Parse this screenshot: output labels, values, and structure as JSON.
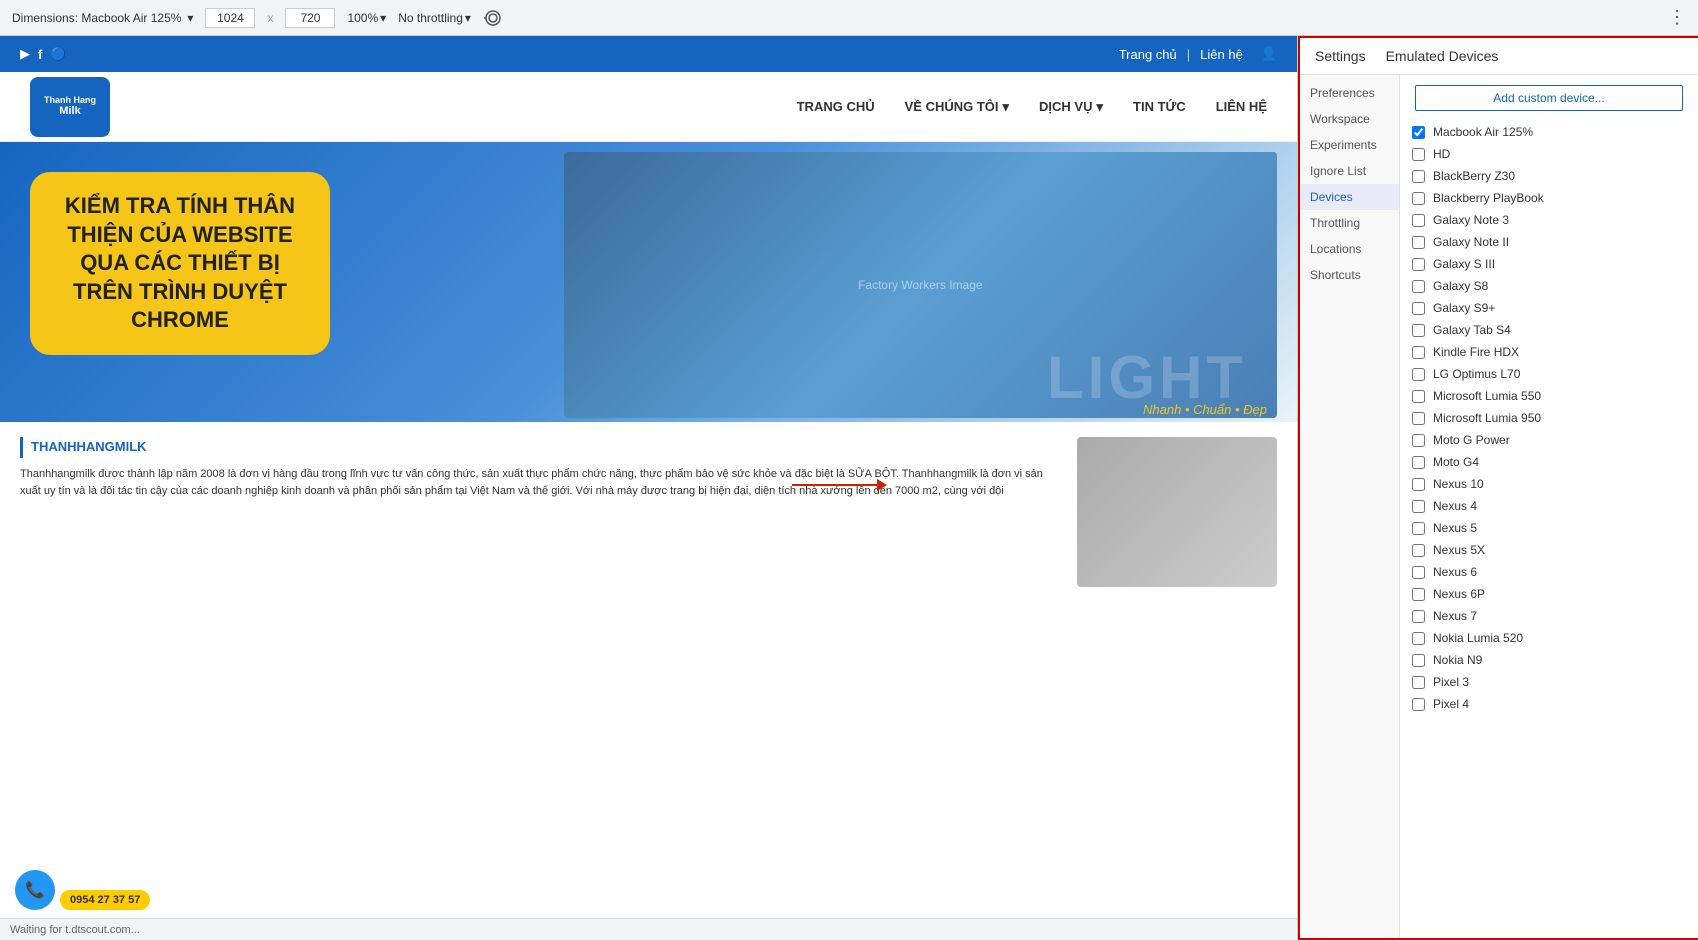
{
  "toolbar": {
    "dimensions_label": "Dimensions: Macbook Air 125%",
    "width": "1024",
    "height": "720",
    "zoom": "100%",
    "throttle": "No throttling",
    "more_label": "⋮"
  },
  "site": {
    "topbar": {
      "icons": [
        "▶",
        "f",
        "🔵"
      ],
      "nav_home": "Trang chủ",
      "nav_contact": "Liên hệ"
    },
    "header": {
      "logo_line1": "Thanh Hang",
      "logo_line2": "Milk",
      "nav_items": [
        "TRANG CHỦ",
        "VỀ CHÚNG TÔI ▾",
        "DỊCH VỤ ▾",
        "TIN TỨC",
        "LIÊN HỆ"
      ]
    },
    "hero": {
      "overlay_text": "KIỂM TRA TÍNH THÂN THIỆN CỦA WEBSITE QUA CÁC THIẾT BỊ TRÊN TRÌNH DUYỆT CHROME",
      "light_text": "LIGHT",
      "nhanh_text": "Nhanh • Chuẩn • Đẹp"
    },
    "content": {
      "section_title": "THANHHANGMILK",
      "body": "Thanhhangmilk được thành lập năm 2008 là đơn vị hàng đầu trong lĩnh vực tư vấn công thức, sản xuất thực phẩm chức năng, thực phẩm bảo vệ sức khỏe và đặc biệt là SỮA BỘT. Thanhhangmilk là đơn vị sản xuất uy tín và là đối tác tin cậy của các doanh nghiệp kinh doanh và phân phối sản phẩm tại Việt Nam và thế giới. Với nhà máy được trang bị hiện đại, diện tích nhà xưởng lên đến 7000 m2, cùng với đội"
    },
    "statusbar": "Waiting for t.dtscout.com..."
  },
  "settings": {
    "title": "Settings",
    "emulated_title": "Emulated Devices",
    "add_button": "Add custom device...",
    "nav_items": [
      {
        "label": "Preferences",
        "active": false
      },
      {
        "label": "Workspace",
        "active": false
      },
      {
        "label": "Experiments",
        "active": false
      },
      {
        "label": "Ignore List",
        "active": false
      },
      {
        "label": "Devices",
        "active": true
      },
      {
        "label": "Throttling",
        "active": false
      },
      {
        "label": "Locations",
        "active": false
      },
      {
        "label": "Shortcuts",
        "active": false
      }
    ],
    "devices": [
      {
        "label": "Macbook Air 125%",
        "checked": true
      },
      {
        "label": "HD",
        "checked": false
      },
      {
        "label": "BlackBerry Z30",
        "checked": false
      },
      {
        "label": "Blackberry PlayBook",
        "checked": false
      },
      {
        "label": "Galaxy Note 3",
        "checked": false
      },
      {
        "label": "Galaxy Note II",
        "checked": false
      },
      {
        "label": "Galaxy S III",
        "checked": false
      },
      {
        "label": "Galaxy S8",
        "checked": false
      },
      {
        "label": "Galaxy S9+",
        "checked": false
      },
      {
        "label": "Galaxy Tab S4",
        "checked": false
      },
      {
        "label": "Kindle Fire HDX",
        "checked": false
      },
      {
        "label": "LG Optimus L70",
        "checked": false
      },
      {
        "label": "Microsoft Lumia 550",
        "checked": false
      },
      {
        "label": "Microsoft Lumia 950",
        "checked": false
      },
      {
        "label": "Moto G Power",
        "checked": false
      },
      {
        "label": "Moto G4",
        "checked": false
      },
      {
        "label": "Nexus 10",
        "checked": false
      },
      {
        "label": "Nexus 4",
        "checked": false
      },
      {
        "label": "Nexus 5",
        "checked": false
      },
      {
        "label": "Nexus 5X",
        "checked": false
      },
      {
        "label": "Nexus 6",
        "checked": false
      },
      {
        "label": "Nexus 6P",
        "checked": false
      },
      {
        "label": "Nexus 7",
        "checked": false
      },
      {
        "label": "Nokia Lumia 520",
        "checked": false
      },
      {
        "label": "Nokia N9",
        "checked": false
      },
      {
        "label": "Pixel 3",
        "checked": false
      },
      {
        "label": "Pixel 4",
        "checked": false
      }
    ]
  }
}
